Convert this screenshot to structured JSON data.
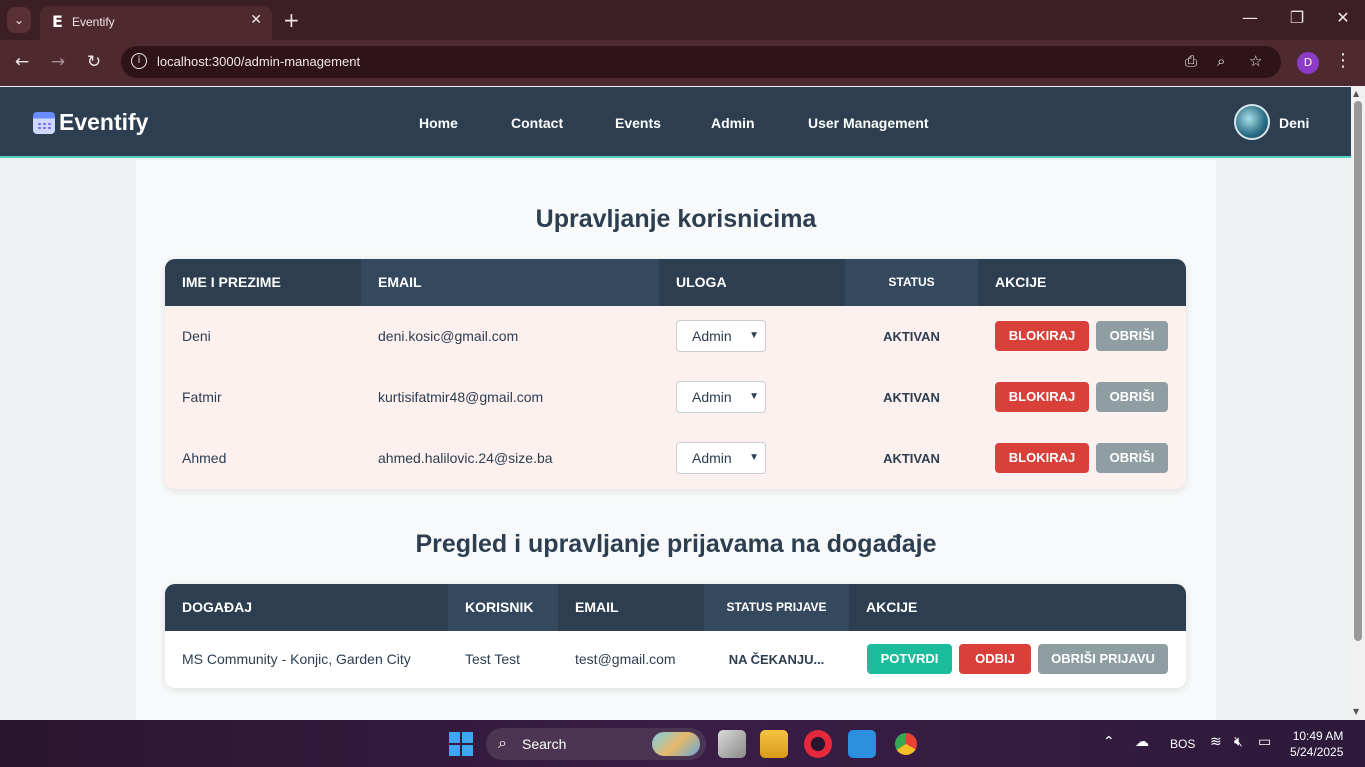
{
  "browser": {
    "tab_title": "Eventify",
    "tab_favicon": "E",
    "url": "localhost:3000/admin-management",
    "profile_initial": "D"
  },
  "app": {
    "brand": "Eventify",
    "nav": [
      "Home",
      "Contact",
      "Events",
      "Admin",
      "User Management"
    ],
    "user_name": "Deni"
  },
  "users_section": {
    "title": "Upravljanje korisnicima",
    "headers": [
      "IME I PREZIME",
      "EMAIL",
      "ULOGA",
      "STATUS",
      "AKCIJE"
    ],
    "rows": [
      {
        "name": "Deni",
        "email": "deni.kosic@gmail.com",
        "role": "Admin",
        "status": "AKTIVAN",
        "block": "BLOKIRAJ",
        "delete": "OBRIŠI"
      },
      {
        "name": "Fatmir",
        "email": "kurtisifatmir48@gmail.com",
        "role": "Admin",
        "status": "AKTIVAN",
        "block": "BLOKIRAJ",
        "delete": "OBRIŠI"
      },
      {
        "name": "Ahmed",
        "email": "ahmed.halilovic.24@size.ba",
        "role": "Admin",
        "status": "AKTIVAN",
        "block": "BLOKIRAJ",
        "delete": "OBRIŠI"
      }
    ]
  },
  "registrations_section": {
    "title": "Pregled i upravljanje prijavama na događaje",
    "headers": [
      "DOGAĐAJ",
      "KORISNIK",
      "EMAIL",
      "STATUS PRIJAVE",
      "AKCIJE"
    ],
    "rows": [
      {
        "event": "MS Community - Konjic, Garden City",
        "user": "Test Test",
        "email": "test@gmail.com",
        "status": "NA ČEKANJU...",
        "confirm": "POTVRDI",
        "reject": "ODBIJ",
        "delete": "OBRIŠI PRIJAVU"
      }
    ]
  },
  "taskbar": {
    "search_placeholder": "Search",
    "language": "BOS",
    "time": "10:49 AM",
    "date": "5/24/2025"
  },
  "colors": {
    "nav_bg": "#2c3e50",
    "danger": "#d9403a",
    "neutral": "#8e9ea3",
    "success": "#1abc9c",
    "user_row_bg": "#fdf1f0"
  }
}
